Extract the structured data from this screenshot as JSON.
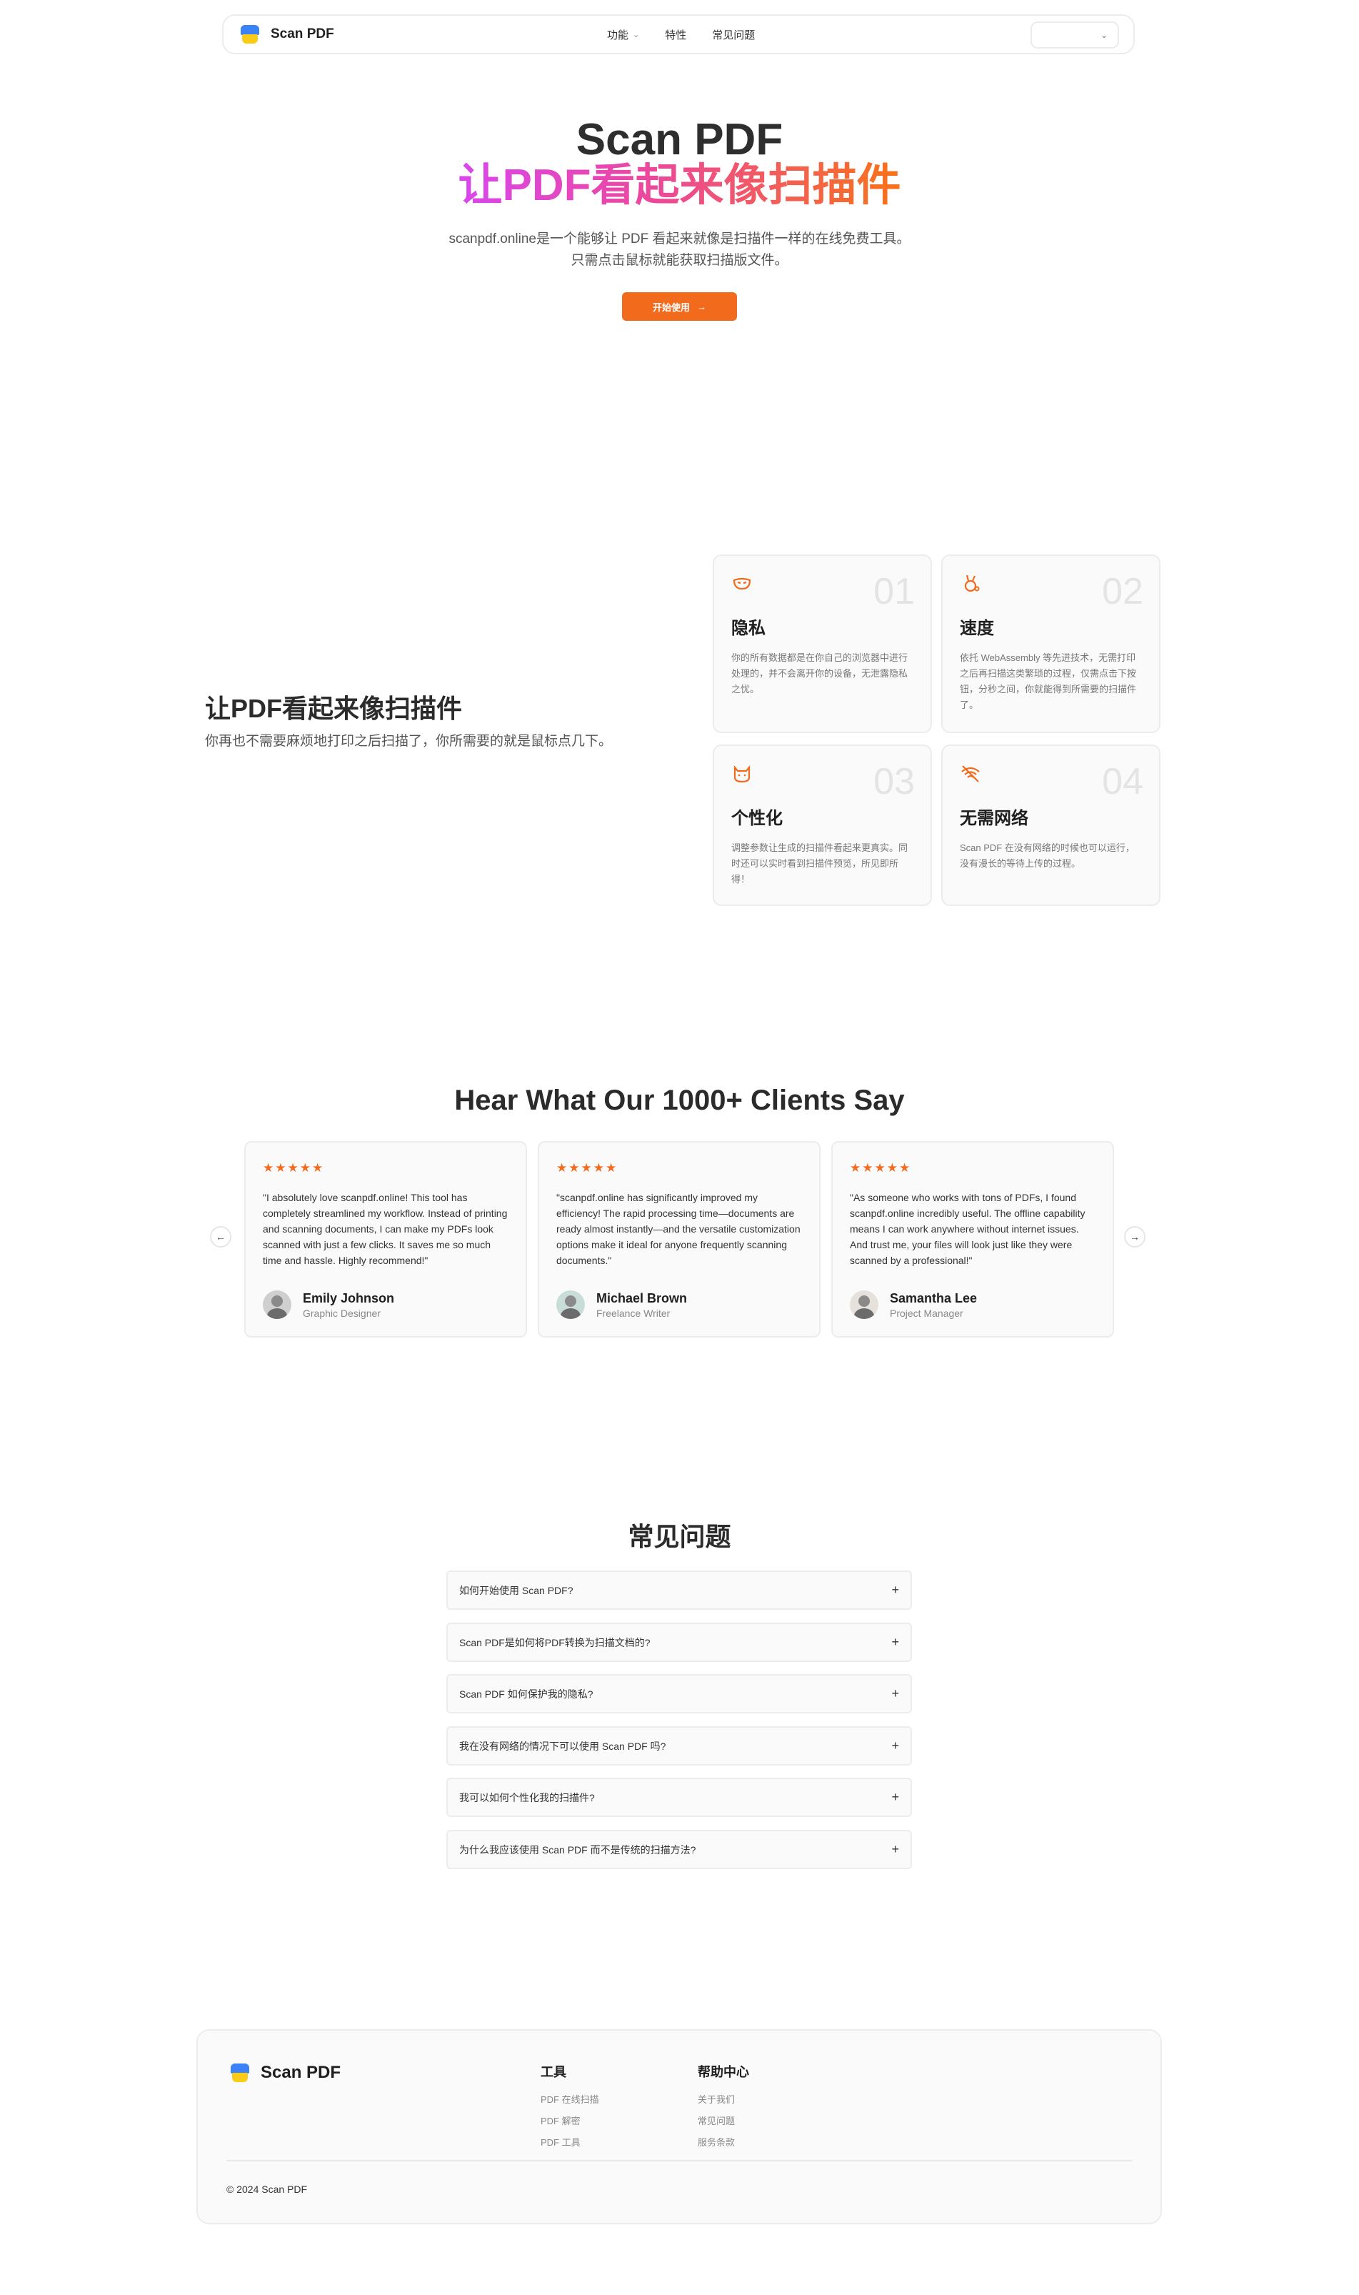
{
  "nav": {
    "brand": "Scan PDF",
    "links": [
      {
        "label": "功能",
        "has_dropdown": true
      },
      {
        "label": "特性",
        "has_dropdown": false
      },
      {
        "label": "常见问题",
        "has_dropdown": false
      }
    ],
    "lang_icon": "chevron-down-icon"
  },
  "hero": {
    "title": "Scan PDF",
    "subtitle": "让PDF看起来像扫描件",
    "description": "scanpdf.online是一个能够让 PDF 看起来就像是扫描件一样的在线免费工具。只需点击鼠标就能获取扫描版文件。",
    "cta_label": "开始使用",
    "cta_icon": "arrow-right-icon"
  },
  "features": {
    "heading": "让PDF看起来像扫描件",
    "description": "你再也不需要麻烦地打印之后扫描了，你所需要的就是鼠标点几下。",
    "cards": [
      {
        "number": "01",
        "icon": "mask-icon",
        "title": "隐私",
        "text": "你的所有数据都是在你自己的浏览器中进行处理的，并不会离开你的设备，无泄露隐私之忧。"
      },
      {
        "number": "02",
        "icon": "rabbit-icon",
        "title": "速度",
        "text": "依托 WebAssembly 等先进技术，无需打印之后再扫描这类繁琐的过程，仅需点击下按钮，分秒之间，你就能得到所需要的扫描件了。"
      },
      {
        "number": "03",
        "icon": "cat-icon",
        "title": "个性化",
        "text": "调整参数让生成的扫描件看起来更真实。同时还可以实时看到扫描件预览，所见即所得！"
      },
      {
        "number": "04",
        "icon": "wifi-off-icon",
        "title": "无需网络",
        "text": "Scan PDF 在没有网络的时候也可以运行，没有漫长的等待上传的过程。"
      }
    ]
  },
  "testimonials": {
    "heading": "Hear What Our 1000+ Clients Say",
    "stars": "★★★★★",
    "items": [
      {
        "quote": "\"I absolutely love scanpdf.online! This tool has completely streamlined my workflow. Instead of printing and scanning documents, I can make my PDFs look scanned with just a few clicks. It saves me so much time and hassle. Highly recommend!\"",
        "name": "Emily Johnson",
        "role": "Graphic Designer"
      },
      {
        "quote": "\"scanpdf.online has significantly improved my efficiency! The rapid processing time—documents are ready almost instantly—and the versatile customization options make it ideal for anyone frequently scanning documents.\"",
        "name": "Michael Brown",
        "role": "Freelance Writer"
      },
      {
        "quote": "\"As someone who works with tons of PDFs, I found scanpdf.online incredibly useful. The offline capability means I can work anywhere without internet issues. And trust me, your files will look just like they were scanned by a professional!\"",
        "name": "Samantha Lee",
        "role": "Project Manager"
      }
    ],
    "prev_icon": "arrow-left-icon",
    "next_icon": "arrow-right-icon"
  },
  "faq": {
    "heading": "常见问题",
    "items": [
      "如何开始使用 Scan PDF?",
      "Scan PDF是如何将PDF转换为扫描文档的?",
      "Scan PDF 如何保护我的隐私?",
      "我在没有网络的情况下可以使用 Scan PDF 吗?",
      "我可以如何个性化我的扫描件?",
      "为什么我应该使用 Scan PDF 而不是传统的扫描方法?"
    ],
    "toggle_icon": "plus-icon"
  },
  "footer": {
    "brand": "Scan PDF",
    "columns": [
      {
        "title": "工具",
        "links": [
          "PDF 在线扫描",
          "PDF 解密",
          "PDF 工具"
        ]
      },
      {
        "title": "帮助中心",
        "links": [
          "关于我们",
          "常见问题",
          "服务条款"
        ]
      }
    ],
    "copyright": "© 2024 Scan PDF"
  },
  "colors": {
    "accent": "#f26b1d",
    "gradient_start": "#d946ef",
    "gradient_end": "#f97316"
  }
}
